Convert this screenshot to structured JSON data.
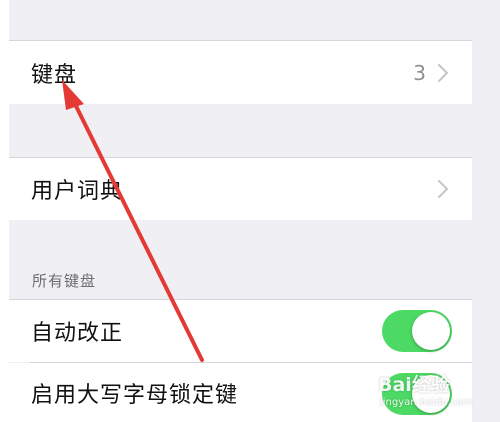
{
  "settings": {
    "keyboard": {
      "label": "键盘",
      "value": "3",
      "chevron_icon": "chevron-right-icon"
    },
    "user_dictionary": {
      "label": "用户词典",
      "chevron_icon": "chevron-right-icon"
    },
    "all_keyboards_header": "所有键盘",
    "auto_correction": {
      "label": "自动改正",
      "enabled": true
    },
    "caps_lock": {
      "label": "启用大写字母锁定键",
      "enabled": true
    }
  },
  "colors": {
    "toggle_on": "#4cd964",
    "annotation_arrow": "#e53935",
    "background": "#efeff4"
  },
  "watermark": {
    "logo": "Bai经验",
    "url": "jingyan.baidu.com"
  }
}
